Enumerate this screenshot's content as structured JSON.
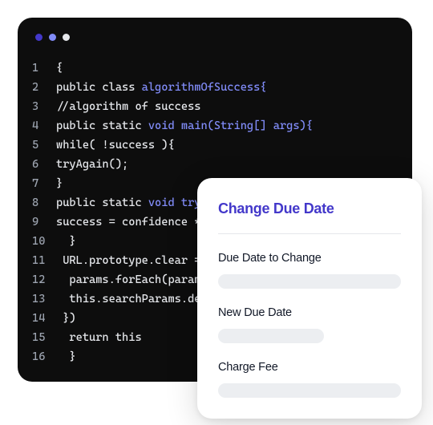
{
  "code": {
    "lines": [
      {
        "n": "1",
        "plain": "{",
        "kw": ""
      },
      {
        "n": "2",
        "plain": "public class ",
        "kw": "algorithmOfSuccess{"
      },
      {
        "n": "3",
        "plain": "//algorithm of success",
        "kw": ""
      },
      {
        "n": "4",
        "plain": "public static ",
        "kw": "void main(String[] args){"
      },
      {
        "n": "5",
        "plain": "while( !success ){",
        "kw": ""
      },
      {
        "n": "6",
        "plain": "tryAgain();",
        "kw": ""
      },
      {
        "n": "7",
        "plain": "}",
        "kw": ""
      },
      {
        "n": "8",
        "plain": "public static ",
        "kw": "void tryAgain(){"
      },
      {
        "n": "9",
        "plain": "success = confidence * work;",
        "kw": ""
      },
      {
        "n": "10",
        "plain": "  }",
        "kw": ""
      },
      {
        "n": "11",
        "plain": " URL.prototype.clear = () => {",
        "kw": ""
      },
      {
        "n": "12",
        "plain": "  params.forEach(param => {",
        "kw": ""
      },
      {
        "n": "13",
        "plain": "  this.searchParams.delete(param)",
        "kw": ""
      },
      {
        "n": "14",
        "plain": " })",
        "kw": ""
      },
      {
        "n": "15",
        "plain": "  return this",
        "kw": ""
      },
      {
        "n": "16",
        "plain": "  }",
        "kw": ""
      }
    ]
  },
  "card": {
    "title": "Change Due Date",
    "fields": [
      {
        "label": "Due Date to Change",
        "short": false
      },
      {
        "label": "New Due Date",
        "short": true
      },
      {
        "label": "Charge Fee",
        "short": false
      }
    ]
  }
}
